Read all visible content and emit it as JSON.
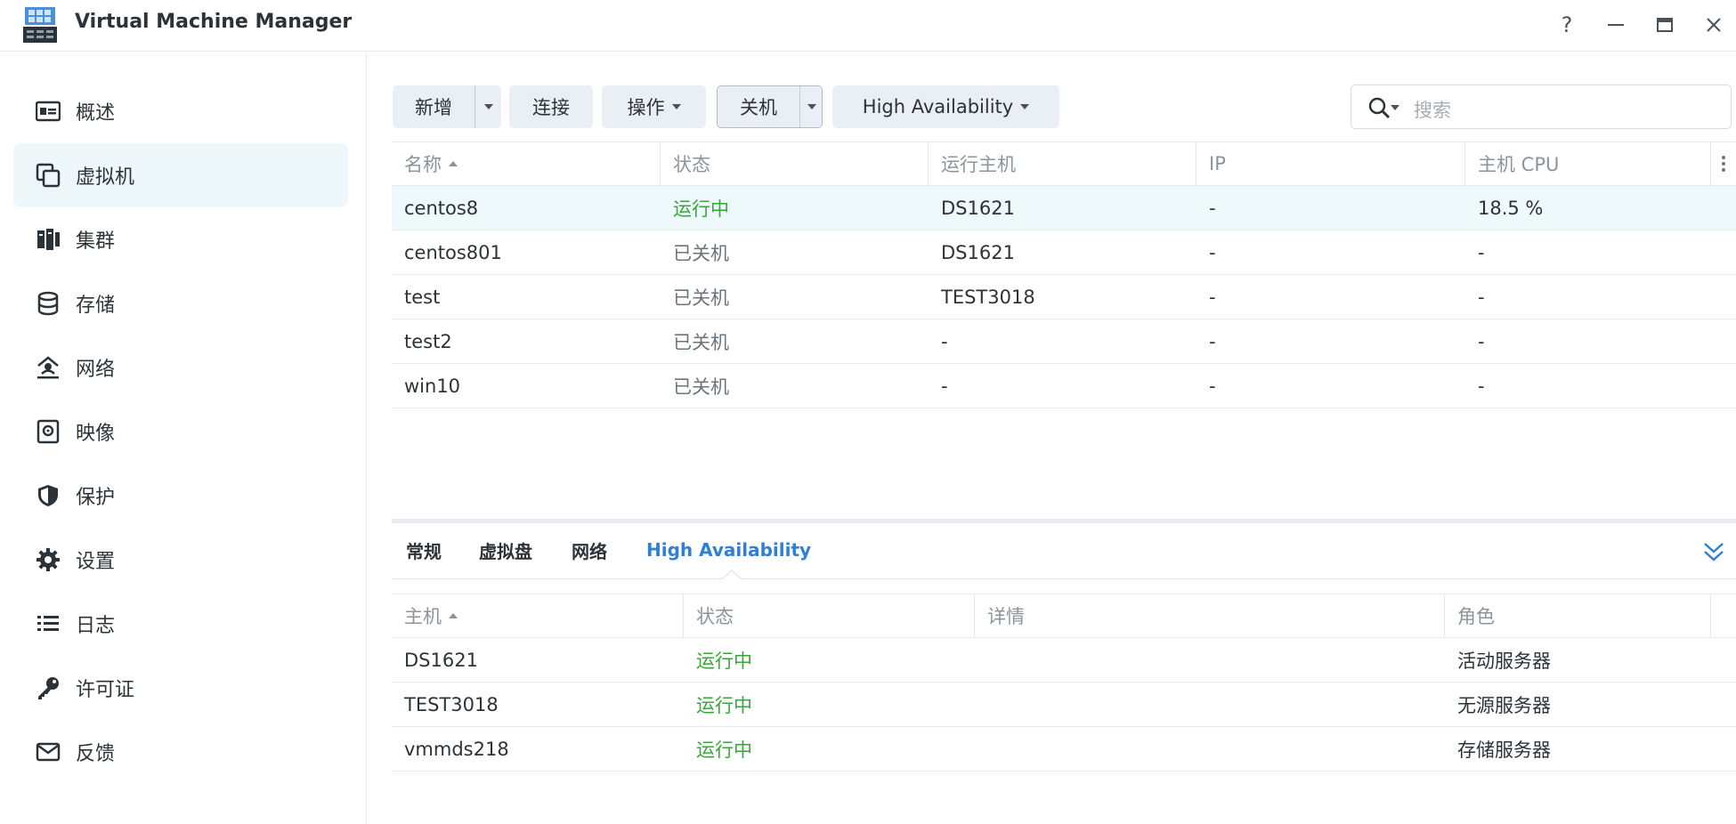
{
  "window": {
    "title": "Virtual Machine Manager",
    "controls": [
      "?",
      "—",
      "□",
      "✕"
    ]
  },
  "sidebar": {
    "items": [
      {
        "label": "概述",
        "icon": "overview-icon"
      },
      {
        "label": "虚拟机",
        "icon": "virtual-machine-icon",
        "active": true
      },
      {
        "label": "集群",
        "icon": "cluster-icon"
      },
      {
        "label": "存储",
        "icon": "storage-icon"
      },
      {
        "label": "网络",
        "icon": "network-icon"
      },
      {
        "label": "映像",
        "icon": "image-icon"
      },
      {
        "label": "保护",
        "icon": "shield-icon"
      },
      {
        "label": "设置",
        "icon": "gear-icon"
      },
      {
        "label": "日志",
        "icon": "log-list-icon"
      },
      {
        "label": "许可证",
        "icon": "key-icon"
      },
      {
        "label": "反馈",
        "icon": "mail-icon"
      }
    ]
  },
  "toolbar": {
    "new_label": "新增",
    "connect_label": "连接",
    "action_label": "操作",
    "shutdown_label": "关机",
    "ha_label": "High Availability"
  },
  "search": {
    "placeholder": "搜索"
  },
  "vm_table": {
    "columns": [
      "名称",
      "状态",
      "运行主机",
      "IP",
      "主机 CPU"
    ],
    "rows": [
      [
        "centos8",
        "运行中",
        "DS1621",
        "-",
        "18.5 %"
      ],
      [
        "centos801",
        "已关机",
        "DS1621",
        "-",
        "-"
      ],
      [
        "test",
        "已关机",
        "TEST3018",
        "-",
        "-"
      ],
      [
        "test2",
        "已关机",
        "-",
        "-",
        "-"
      ],
      [
        "win10",
        "已关机",
        "-",
        "-",
        "-"
      ]
    ]
  },
  "detail_tabs": {
    "general": "常规",
    "vdisk": "虚拟盘",
    "network": "网络",
    "ha": "High Availability"
  },
  "ha_table": {
    "columns": [
      "主机",
      "状态",
      "详情",
      "角色"
    ],
    "rows": [
      [
        "DS1621",
        "运行中",
        "",
        "活动服务器"
      ],
      [
        "TEST3018",
        "运行中",
        "",
        "无源服务器"
      ],
      [
        "vmmds218",
        "运行中",
        "",
        "存储服务器"
      ]
    ]
  },
  "colors": {
    "accent": "#2d7fd8",
    "running": "#3aa53a",
    "selected_row": "#eef9fb"
  }
}
